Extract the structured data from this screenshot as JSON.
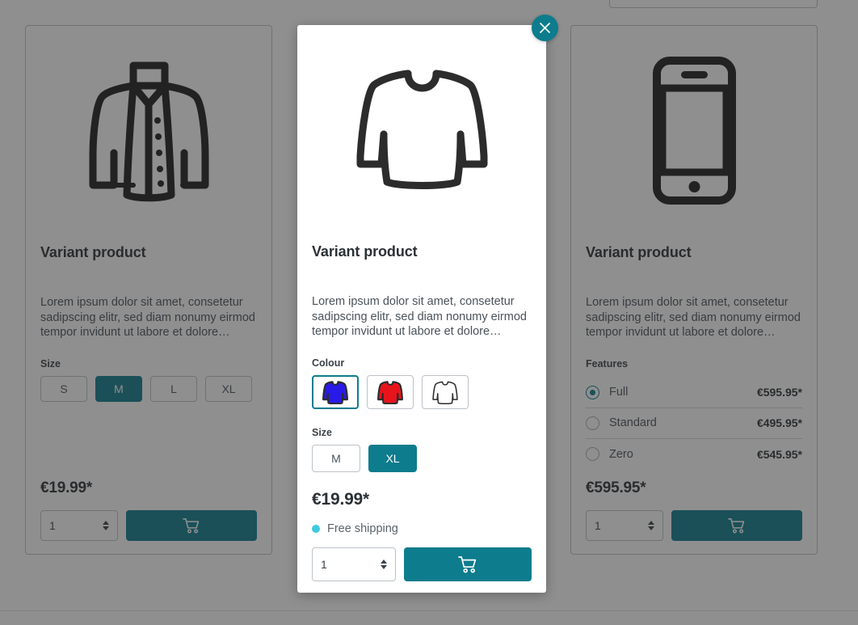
{
  "theme": {
    "accent": "#0d7c8c",
    "accent_dimmed": "#0a4a52",
    "shipping_dot": "#3ec9de",
    "text_dark": "#2b3136",
    "text_muted": "#4a525a",
    "card_border": "#bcc1c7",
    "overlay": "rgba(40,40,40,0.52)"
  },
  "cards": [
    {
      "id": "left-card",
      "icon": "jacket-icon",
      "title": "Variant product",
      "description": "Lorem ipsum dolor sit amet, consetetur sadipscing elitr, sed diam nonumy eirmod tempor invidunt ut labore et dolore…",
      "option_group_label": "Size",
      "options": [
        {
          "label": "S",
          "selected": false
        },
        {
          "label": "M",
          "selected": true
        },
        {
          "label": "L",
          "selected": false
        },
        {
          "label": "XL",
          "selected": false
        }
      ],
      "price": "€19.99*",
      "quantity": "1",
      "cart_icon": "shopping-cart-icon"
    },
    {
      "id": "right-card",
      "icon": "smartphone-icon",
      "title": "Variant product",
      "description": "Lorem ipsum dolor sit amet, consetetur sadipscing elitr, sed diam nonumy eirmod tempor invidunt ut labore et dolore…",
      "option_group_label": "Features",
      "features": [
        {
          "label": "Full",
          "price": "€595.95*",
          "selected": true
        },
        {
          "label": "Standard",
          "price": "€495.95*",
          "selected": false
        },
        {
          "label": "Zero",
          "price": "€545.95*",
          "selected": false
        }
      ],
      "price": "€595.95*",
      "quantity": "1",
      "cart_icon": "shopping-cart-icon"
    }
  ],
  "modal": {
    "close_label": "×",
    "close_icon": "close-icon",
    "icon": "longsleeve-shirt-icon",
    "title": "Variant product",
    "description": "Lorem ipsum dolor sit amet, consetetur sadipscing elitr, sed diam nonumy eirmod tempor invidunt ut labore et dolore…",
    "colour_label": "Colour",
    "colours": [
      {
        "name": "blue",
        "hex": "#2a1ae8",
        "selected": true
      },
      {
        "name": "red",
        "hex": "#e8141c",
        "selected": false
      },
      {
        "name": "white",
        "hex": "#ffffff",
        "selected": false
      }
    ],
    "size_label": "Size",
    "sizes": [
      {
        "label": "M",
        "selected": false
      },
      {
        "label": "XL",
        "selected": true
      }
    ],
    "price": "€19.99*",
    "shipping_text": "Free shipping",
    "quantity": "1",
    "cart_icon": "shopping-cart-icon"
  }
}
